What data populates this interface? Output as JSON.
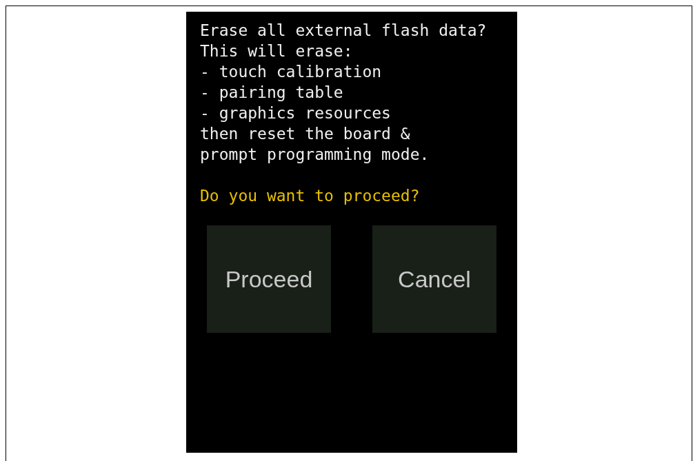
{
  "message_lines": [
    "Erase all external flash data?",
    "This will erase:",
    "- touch calibration",
    "- pairing table",
    "- graphics resources",
    "then reset the board &",
    "prompt programming mode."
  ],
  "question": "Do you want to proceed?",
  "buttons": [
    {
      "label": "Proceed"
    },
    {
      "label": "Cancel"
    }
  ]
}
